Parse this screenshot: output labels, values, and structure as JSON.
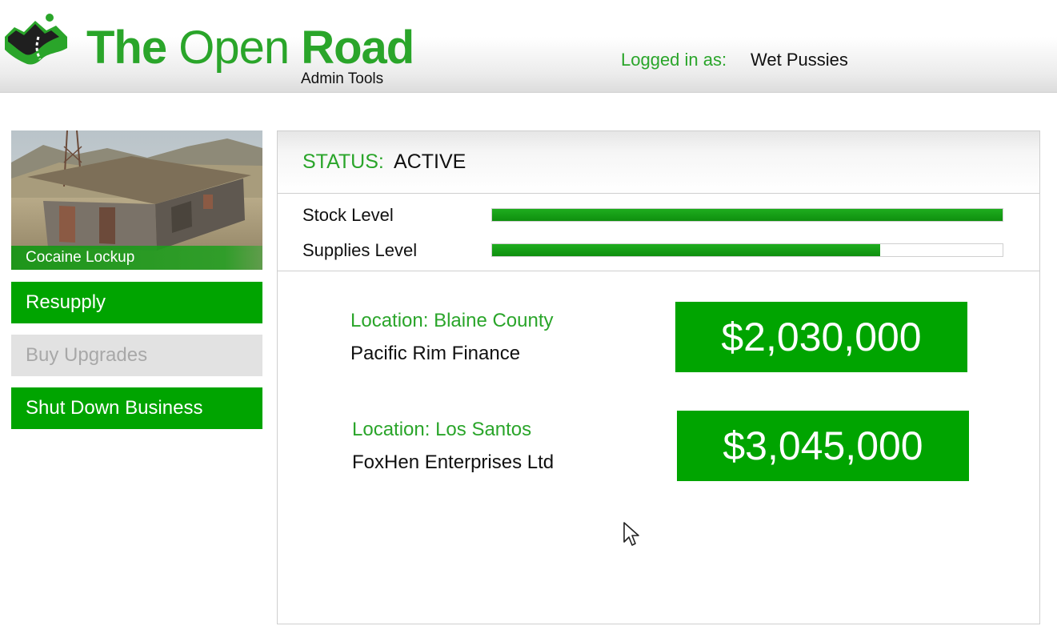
{
  "header": {
    "brand_part1": "The ",
    "brand_part2": "Open ",
    "brand_part3": "Road",
    "subtitle": "Admin Tools",
    "login_label": "Logged in as:",
    "login_user": "Wet Pussies",
    "logo_icon": "mountain-road-logo-icon"
  },
  "sidebar": {
    "business_caption": "Cocaine Lockup",
    "buttons": {
      "resupply": "Resupply",
      "upgrades": "Buy Upgrades",
      "shutdown": "Shut Down Business"
    }
  },
  "main": {
    "status_label": "STATUS:",
    "status_value": "ACTIVE",
    "levels": [
      {
        "label": "Stock Level",
        "fraction": 1.0
      },
      {
        "label": "Supplies Level",
        "fraction": 0.76
      }
    ],
    "offers": [
      {
        "location": "Location: Blaine County",
        "buyer": "Pacific Rim Finance",
        "price": "$2,030,000"
      },
      {
        "location": "Location: Los Santos",
        "buyer": "FoxHen Enterprises Ltd",
        "price": "$3,045,000"
      }
    ]
  },
  "colors": {
    "brand_green": "#2aa52a",
    "button_green": "#00a400",
    "disabled_gray": "#e2e2e2",
    "text_dark": "#111111"
  }
}
